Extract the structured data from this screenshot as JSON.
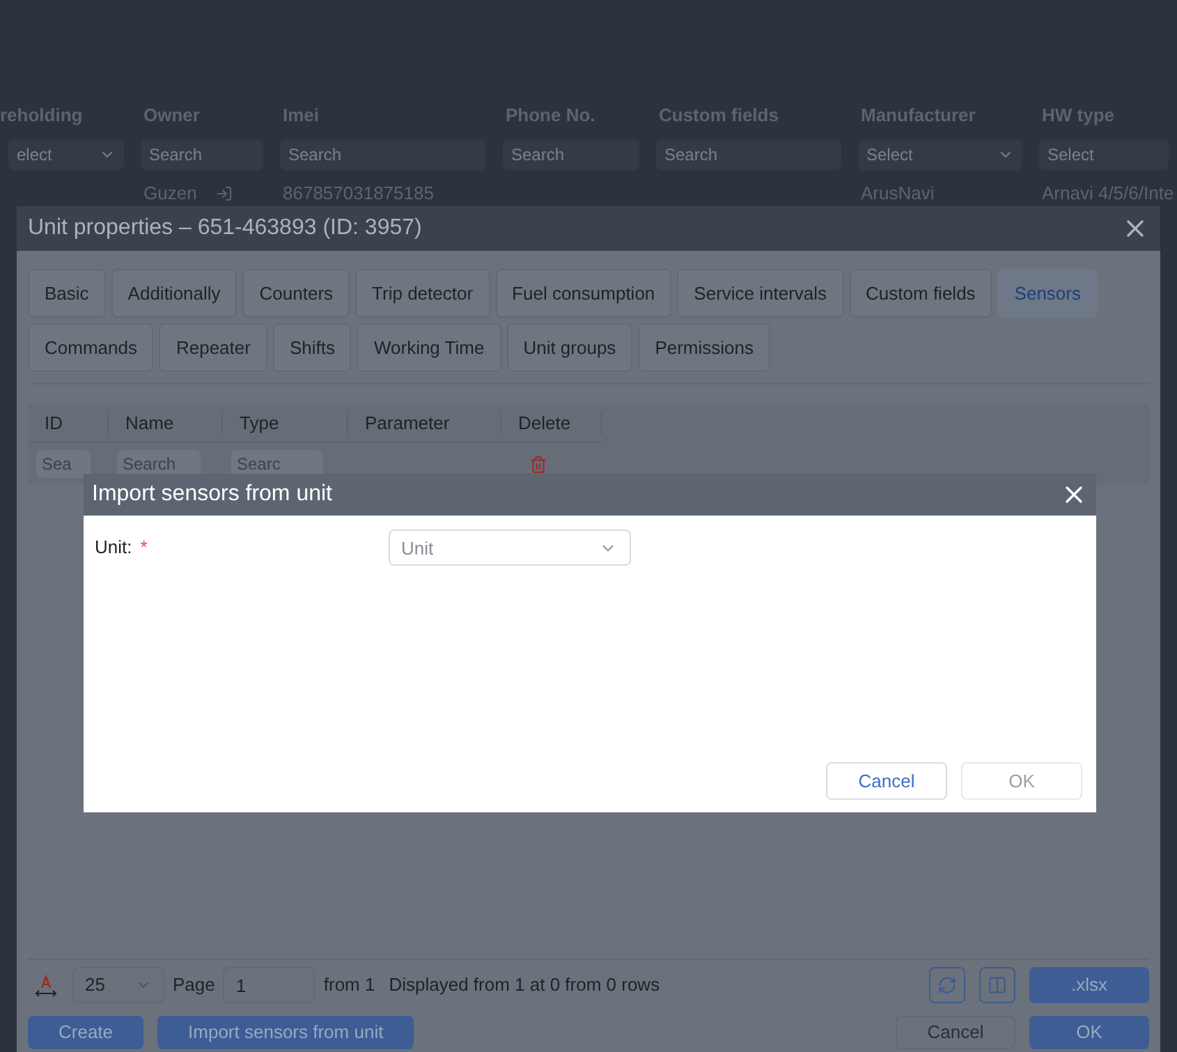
{
  "background_table": {
    "columns": [
      {
        "label": "reholding",
        "filter": {
          "kind": "select",
          "placeholder": "elect"
        }
      },
      {
        "label": "Owner",
        "filter": {
          "kind": "search",
          "placeholder": "Search"
        },
        "cell": "Guzen"
      },
      {
        "label": "Imei",
        "filter": {
          "kind": "search",
          "placeholder": "Search"
        },
        "cell": "867857031875185"
      },
      {
        "label": "Phone No.",
        "filter": {
          "kind": "search",
          "placeholder": "Search"
        }
      },
      {
        "label": "Custom fields",
        "filter": {
          "kind": "search",
          "placeholder": "Search"
        }
      },
      {
        "label": "Manufacturer",
        "filter": {
          "kind": "select",
          "placeholder": "Select"
        },
        "cell": "ArusNavi"
      },
      {
        "label": "HW type",
        "filter": {
          "kind": "search",
          "placeholder": "Select"
        },
        "cell": "Arnavi 4/5/6/Inte"
      }
    ]
  },
  "unit_dialog": {
    "title": "Unit properties – 651-463893 (ID: 3957)",
    "tab_rows": [
      [
        {
          "label": "Basic",
          "selected": false
        },
        {
          "label": "Additionally",
          "selected": false
        },
        {
          "label": "Counters",
          "selected": false
        },
        {
          "label": "Trip detector",
          "selected": false
        },
        {
          "label": "Fuel consumption",
          "selected": false
        },
        {
          "label": "Service intervals",
          "selected": false
        },
        {
          "label": "Custom fields",
          "selected": false
        },
        {
          "label": "Sensors",
          "selected": true
        }
      ],
      [
        {
          "label": "Commands",
          "selected": false
        },
        {
          "label": "Repeater",
          "selected": false
        },
        {
          "label": "Shifts",
          "selected": false
        },
        {
          "label": "Working Time",
          "selected": false
        },
        {
          "label": "Unit groups",
          "selected": false
        },
        {
          "label": "Permissions",
          "selected": false
        }
      ]
    ],
    "table": {
      "columns": [
        {
          "label": "ID",
          "filter": {
            "kind": "search",
            "placeholder": "Sea"
          }
        },
        {
          "label": "Name",
          "filter": {
            "kind": "search",
            "placeholder": "Search"
          }
        },
        {
          "label": "Type",
          "filter": {
            "kind": "search",
            "placeholder": "Searc"
          }
        },
        {
          "label": "Parameter",
          "filter": {
            "kind": "none"
          }
        },
        {
          "label": "Delete",
          "filter": {
            "kind": "delete"
          }
        }
      ]
    },
    "pager": {
      "page_size": "25",
      "page_label": "Page",
      "page": "1",
      "of_pages": "from 1",
      "summary": "Displayed from 1 at 0 from 0 rows",
      "export": ".xlsx"
    },
    "buttons_left": [
      "Create",
      "Import sensors from unit"
    ],
    "buttons_right": [
      {
        "label": "Cancel",
        "kind": "secondary"
      },
      {
        "label": "OK",
        "kind": "primary"
      }
    ]
  },
  "import_dialog": {
    "title": "Import sensors from unit",
    "field": {
      "label": "Unit:",
      "required_mark": "*",
      "placeholder": "Unit"
    },
    "buttons": [
      {
        "label": "Cancel",
        "disabled": false
      },
      {
        "label": "OK",
        "disabled": true
      }
    ]
  }
}
